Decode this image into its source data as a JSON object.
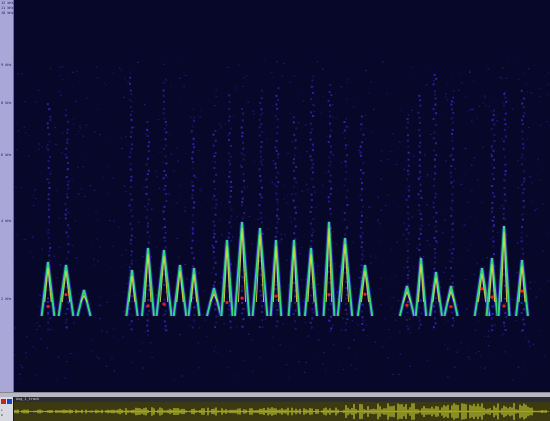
{
  "frequency_axis": {
    "labels": [
      "12 kHz",
      "11 kHz",
      "10 kHz",
      "9 kHz",
      "8 kHz",
      "6 kHz",
      "4 kHz",
      "2 kHz"
    ]
  },
  "channel": {
    "left_label": "L",
    "right_label": "R"
  },
  "track": {
    "label": "Aug_1_track"
  },
  "colors": {
    "background": "#07072a",
    "axis": "#a9a6d8",
    "low_energy": "#3a2bd0",
    "mid_energy": "#33d67a",
    "high_energy": "#e8e030",
    "peak_energy": "#e02020",
    "waveform_bg": "#3d3a12",
    "waveform": "#d6e030"
  },
  "icons": {
    "channel_left": "red-channel-icon",
    "channel_right": "blue-channel-icon"
  }
}
